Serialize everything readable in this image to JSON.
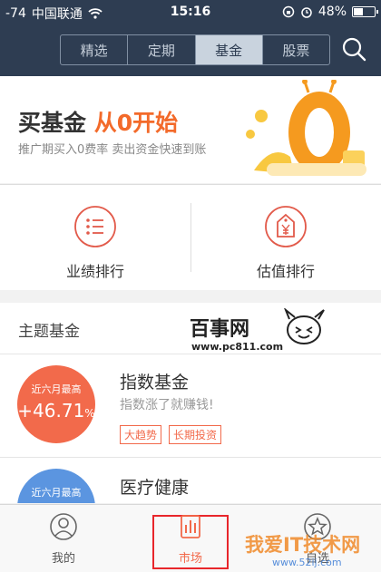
{
  "status_bar": {
    "signal": "-74",
    "carrier": "中国联通",
    "time": "15:16",
    "battery": "48%",
    "battery_level": 0.48
  },
  "tabs": [
    {
      "label": "精选",
      "active": false
    },
    {
      "label": "定期",
      "active": false
    },
    {
      "label": "基金",
      "active": true
    },
    {
      "label": "股票",
      "active": false
    }
  ],
  "banner": {
    "title_part1": "买基金",
    "title_part2": "从0开始",
    "subtitle": "推广期买入0费率 卖出资金快速到账"
  },
  "actions": [
    {
      "label": "业绩排行",
      "icon": "list-icon"
    },
    {
      "label": "估值排行",
      "icon": "yen-tag-icon"
    }
  ],
  "section": {
    "title": "主题基金"
  },
  "funds": [
    {
      "period": "近六月最高",
      "rate": "+46.71",
      "rate_unit": "%",
      "name": "指数基金",
      "desc": "指数涨了就赚钱!",
      "tags": [
        "大趋势",
        "长期投资"
      ]
    },
    {
      "period": "近六月最高",
      "name": "医疗健康"
    }
  ],
  "tabbar": [
    {
      "label": "我的",
      "icon": "user-icon",
      "active": false
    },
    {
      "label": "市场",
      "icon": "market-icon",
      "active": true
    },
    {
      "label": "自选",
      "icon": "star-icon",
      "active": false
    }
  ],
  "watermark": {
    "brand": "百事网",
    "url": "www.pc811.com",
    "brand2": "我爱IT技术网",
    "url2": "www.52ij.com"
  },
  "colors": {
    "header": "#2e3d52",
    "accent": "#f26a4b",
    "blue": "#5b95e0"
  }
}
